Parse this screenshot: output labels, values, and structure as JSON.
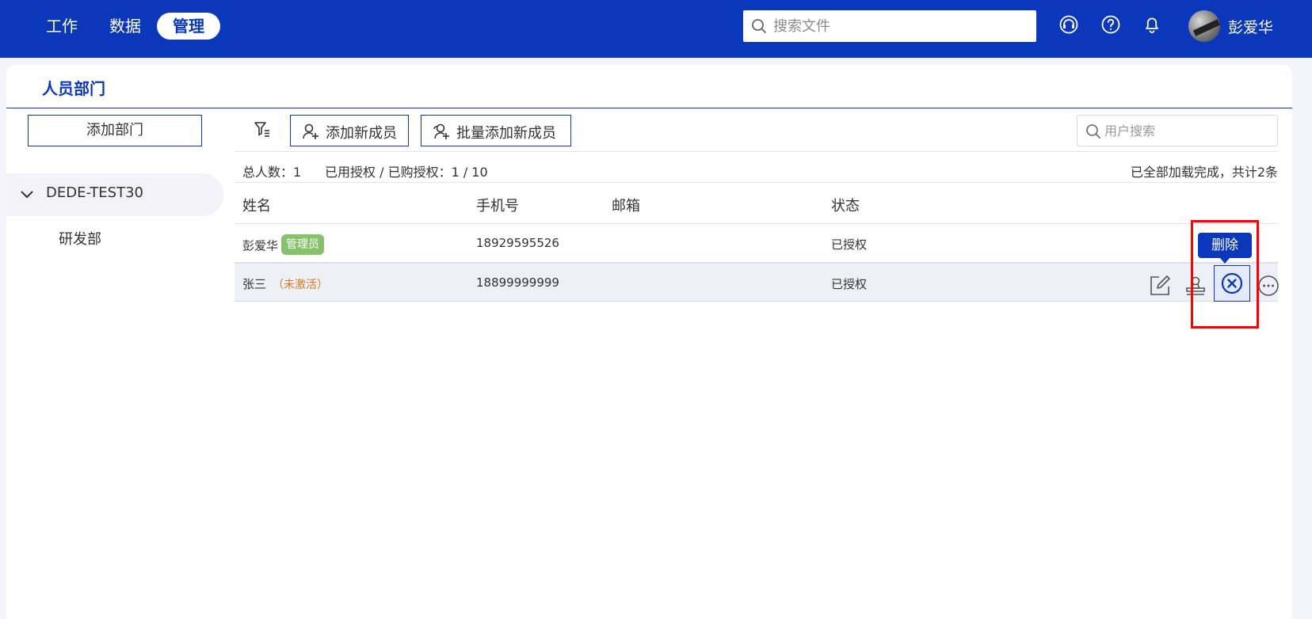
{
  "topnav": {
    "items": [
      {
        "label": "工作"
      },
      {
        "label": "数据"
      },
      {
        "label": "管理"
      }
    ],
    "active_index": 2,
    "search_placeholder": "搜索文件",
    "icons": [
      "headset-icon",
      "help-icon",
      "bell-icon"
    ],
    "username": "彭爱华",
    "color": "#0b38ba"
  },
  "panel": {
    "title": "人员部门"
  },
  "sidebar": {
    "add_dept_label": "添加部门",
    "tree": {
      "root_label": "DEDE-TEST30",
      "expanded": true,
      "children": [
        "研发部"
      ]
    }
  },
  "toolbar": {
    "add_member_label": "添加新成员",
    "batch_add_label": "批量添加新成员",
    "user_search_placeholder": "用户搜索"
  },
  "stats": {
    "total_label": "总人数：1",
    "license_label": "已用授权 / 已购授权：1 / 10",
    "loaded_label": "已全部加载完成，共计2条"
  },
  "table": {
    "headers": {
      "name": "姓名",
      "phone": "手机号",
      "email": "邮箱",
      "status": "状态"
    },
    "rows": [
      {
        "name": "彭爱华",
        "badge": "管理员",
        "phone": "18929595526",
        "email": "",
        "status": "已授权"
      },
      {
        "name": "张三",
        "tag": "（未激活）",
        "phone": "18899999999",
        "email": "",
        "status": "已授权"
      }
    ],
    "row_actions_icons": [
      "edit-icon",
      "user-permission-icon",
      "delete-icon",
      "more-icon"
    ],
    "admin_badge_color": "#86c26b",
    "inactive_color": "#d77a1e"
  },
  "tooltip": {
    "label": "删除"
  },
  "highlight_color": "#ff0000"
}
